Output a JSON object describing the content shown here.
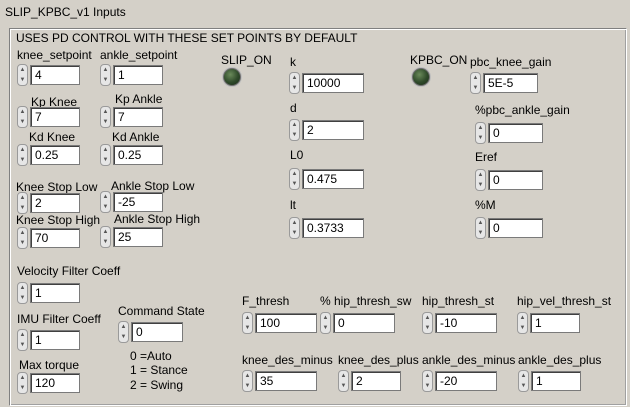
{
  "window": {
    "title": "SLIP_KPBC_v1 Inputs"
  },
  "panel": {
    "header": "USES PD CONTROL WITH THESE SET POINTS BY DEFAULT"
  },
  "indicators": {
    "slip_on": "SLIP_ON",
    "kpbc_on": "KPBC_ON"
  },
  "controls": {
    "knee_setpoint": {
      "label": "knee_setpoint",
      "value": "4"
    },
    "ankle_setpoint": {
      "label": "ankle_setpoint",
      "value": "1"
    },
    "kp_knee": {
      "label": "Kp Knee",
      "value": "7"
    },
    "kp_ankle": {
      "label": "Kp Ankle",
      "value": "7"
    },
    "kd_knee": {
      "label": "Kd Knee",
      "value": "0.25"
    },
    "kd_ankle": {
      "label": "Kd Ankle",
      "value": "0.25"
    },
    "knee_stop_low": {
      "label": "Knee Stop Low",
      "value": "2"
    },
    "ankle_stop_low": {
      "label": "Ankle Stop Low",
      "value": "-25"
    },
    "knee_stop_high": {
      "label": "Knee Stop High",
      "value": "70"
    },
    "ankle_stop_high": {
      "label": "Ankle Stop High",
      "value": "25"
    },
    "k": {
      "label": "k",
      "value": "10000"
    },
    "d": {
      "label": "d",
      "value": "2"
    },
    "l0": {
      "label": "L0",
      "value": "0.475"
    },
    "lt": {
      "label": "lt",
      "value": "0.3733"
    },
    "pbc_knee_gain": {
      "label": "pbc_knee_gain",
      "value": "5E-5"
    },
    "pbc_ankle_gain": {
      "label": "%pbc_ankle_gain",
      "value": "0"
    },
    "eref": {
      "label": "Eref",
      "value": "0"
    },
    "m": {
      "label": "%M",
      "value": "0"
    },
    "velocity_filter_coeff": {
      "label": "Velocity Filter Coeff",
      "value": "1"
    },
    "imu_filter_coeff": {
      "label": "IMU Filter Coeff",
      "value": "1"
    },
    "max_torque": {
      "label": "Max torque",
      "value": "120"
    },
    "command_state": {
      "label": "Command State",
      "value": "0",
      "legend": [
        "0 =Auto",
        "1 = Stance",
        "2 = Swing"
      ]
    },
    "f_thresh": {
      "label": "F_thresh",
      "value": "100"
    },
    "hip_thresh_sw": {
      "label": "% hip_thresh_sw",
      "value": "0"
    },
    "hip_thresh_st": {
      "label": "hip_thresh_st",
      "value": "-10"
    },
    "hip_vel_thresh_st": {
      "label": "hip_vel_thresh_st",
      "value": "1"
    },
    "knee_des_minus": {
      "label": "knee_des_minus",
      "value": "35"
    },
    "knee_des_plus": {
      "label": "knee_des_plus",
      "value": "2"
    },
    "ankle_des_minus": {
      "label": "ankle_des_minus",
      "value": "-20"
    },
    "ankle_des_plus": {
      "label": "ankle_des_plus",
      "value": "1"
    }
  },
  "icons": {
    "increment": "triangle-up-icon",
    "decrement": "triangle-down-icon"
  }
}
